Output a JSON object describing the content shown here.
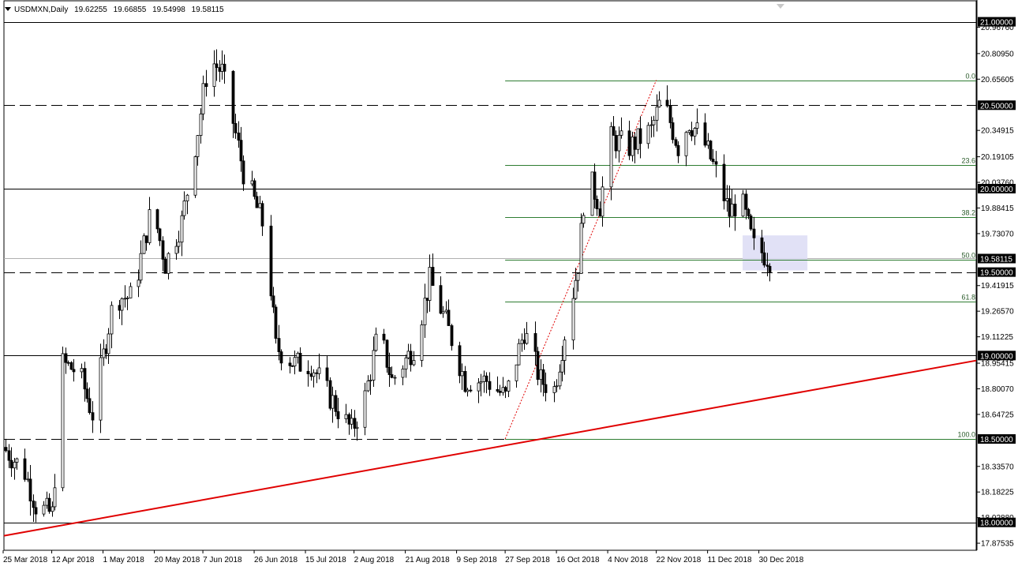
{
  "header": {
    "symbol": "USDMXN,Daily",
    "open": "19.62255",
    "high": "19.66855",
    "low": "19.54998",
    "close": "19.58115"
  },
  "colors": {
    "background": "#ffffff",
    "candle": "#000000",
    "fib_line": "#2e7d32",
    "trendline": "#e00000",
    "fib_diagonal": "#e00000",
    "support_zone": "#dcdcf5",
    "price_tag_bg": "#000000",
    "price_tag_text": "#ffffff"
  },
  "icons": [
    "dropdown-triangle-icon",
    "scroll-down-triangle-icon"
  ],
  "chart_data": {
    "type": "candlestick",
    "title": "USDMXN,Daily",
    "ylim": [
      17.8,
      21.05
    ],
    "y_ticks": [
      "20.96760",
      "20.80950",
      "20.65605",
      "20.34915",
      "20.19105",
      "20.03760",
      "19.88415",
      "19.73070",
      "19.41915",
      "19.26570",
      "19.11225",
      "18.95415",
      "18.80070",
      "18.64725",
      "18.33570",
      "18.18225",
      "18.02880",
      "17.87535"
    ],
    "x_labels": [
      "25 Mar 2018",
      "12 Apr 2018",
      "1 May 2018",
      "20 May 2018",
      "7 Jun 2018",
      "26 Jun 2018",
      "15 Jul 2018",
      "2 Aug 2018",
      "21 Aug 2018",
      "9 Sep 2018",
      "27 Sep 2018",
      "16 Oct 2018",
      "4 Nov 2018",
      "22 Nov 2018",
      "11 Dec 2018",
      "30 Dec 2018"
    ],
    "horizontal_levels": [
      {
        "label": "21.00000",
        "value": 21.0,
        "style": "solid"
      },
      {
        "label": "20.50000",
        "value": 20.5,
        "style": "dashed"
      },
      {
        "label": "20.00000",
        "value": 20.0,
        "style": "solid"
      },
      {
        "label": "19.50000",
        "value": 19.5,
        "style": "dashed"
      },
      {
        "label": "19.00000",
        "value": 19.0,
        "style": "solid"
      },
      {
        "label": "18.50000",
        "value": 18.5,
        "style": "dashed"
      },
      {
        "label": "18.00000",
        "value": 18.0,
        "style": "solid"
      }
    ],
    "current_price": {
      "label": "19.58115",
      "value": 19.58115
    },
    "fibonacci": {
      "from": {
        "date": "27 Sep 2018",
        "price": 18.5
      },
      "to": {
        "date": "22 Nov 2018",
        "price": 20.65
      },
      "levels": [
        {
          "label": "0.0",
          "ratio": 0.0
        },
        {
          "label": "23.6",
          "ratio": 0.236
        },
        {
          "label": "38.2",
          "ratio": 0.382
        },
        {
          "label": "50.0",
          "ratio": 0.5
        },
        {
          "label": "61.8",
          "ratio": 0.618
        },
        {
          "label": "100.0",
          "ratio": 1.0
        }
      ]
    },
    "trendline": {
      "start": {
        "date": "25 Mar 2018",
        "price": 17.92
      },
      "end": {
        "date": "4 Jan 2019",
        "price": 18.75
      }
    },
    "support_zone": {
      "from_date": "24 Dec 2018",
      "to_date": "17 Jan 2019",
      "top": 19.72,
      "bottom": 19.51
    },
    "swing_points": [
      [
        "2018-03-25",
        18.45
      ],
      [
        "2018-04-02",
        18.3
      ],
      [
        "2018-04-06",
        18.1
      ],
      [
        "2018-04-12",
        18.05
      ],
      [
        "2018-04-16",
        18.95
      ],
      [
        "2018-04-22",
        18.9
      ],
      [
        "2018-04-27",
        18.65
      ],
      [
        "2018-05-05",
        19.35
      ],
      [
        "2018-05-12",
        19.35
      ],
      [
        "2018-05-19",
        19.9
      ],
      [
        "2018-05-24",
        19.55
      ],
      [
        "2018-05-30",
        19.8
      ],
      [
        "2018-06-05",
        20.35
      ],
      [
        "2018-06-09",
        20.78
      ],
      [
        "2018-06-14",
        20.7
      ],
      [
        "2018-06-22",
        20.1
      ],
      [
        "2018-06-30",
        19.75
      ],
      [
        "2018-07-04",
        19.05
      ],
      [
        "2018-07-11",
        18.95
      ],
      [
        "2018-07-17",
        18.95
      ],
      [
        "2018-07-24",
        18.75
      ],
      [
        "2018-08-01",
        18.55
      ],
      [
        "2018-08-06",
        18.75
      ],
      [
        "2018-08-11",
        19.15
      ],
      [
        "2018-08-16",
        18.85
      ],
      [
        "2018-08-24",
        19.05
      ],
      [
        "2018-08-30",
        19.45
      ],
      [
        "2018-09-05",
        19.2
      ],
      [
        "2018-09-12",
        18.85
      ],
      [
        "2018-09-20",
        18.85
      ],
      [
        "2018-09-27",
        18.75
      ],
      [
        "2018-10-04",
        19.15
      ],
      [
        "2018-10-10",
        18.85
      ],
      [
        "2018-10-15",
        18.8
      ],
      [
        "2018-10-21",
        19.3
      ],
      [
        "2018-10-24",
        19.55
      ],
      [
        "2018-10-27",
        20.1
      ],
      [
        "2018-11-01",
        19.9
      ],
      [
        "2018-11-05",
        20.3
      ],
      [
        "2018-11-12",
        20.25
      ],
      [
        "2018-11-20",
        20.35
      ],
      [
        "2018-11-24",
        20.55
      ],
      [
        "2018-11-30",
        20.25
      ],
      [
        "2018-12-04",
        20.4
      ],
      [
        "2018-12-09",
        20.3
      ],
      [
        "2018-12-14",
        20.1
      ],
      [
        "2018-12-19",
        19.85
      ],
      [
        "2018-12-23",
        19.95
      ],
      [
        "2018-12-28",
        19.65
      ],
      [
        "2018-12-31",
        19.62
      ],
      [
        "2019-01-03",
        19.58
      ]
    ]
  }
}
